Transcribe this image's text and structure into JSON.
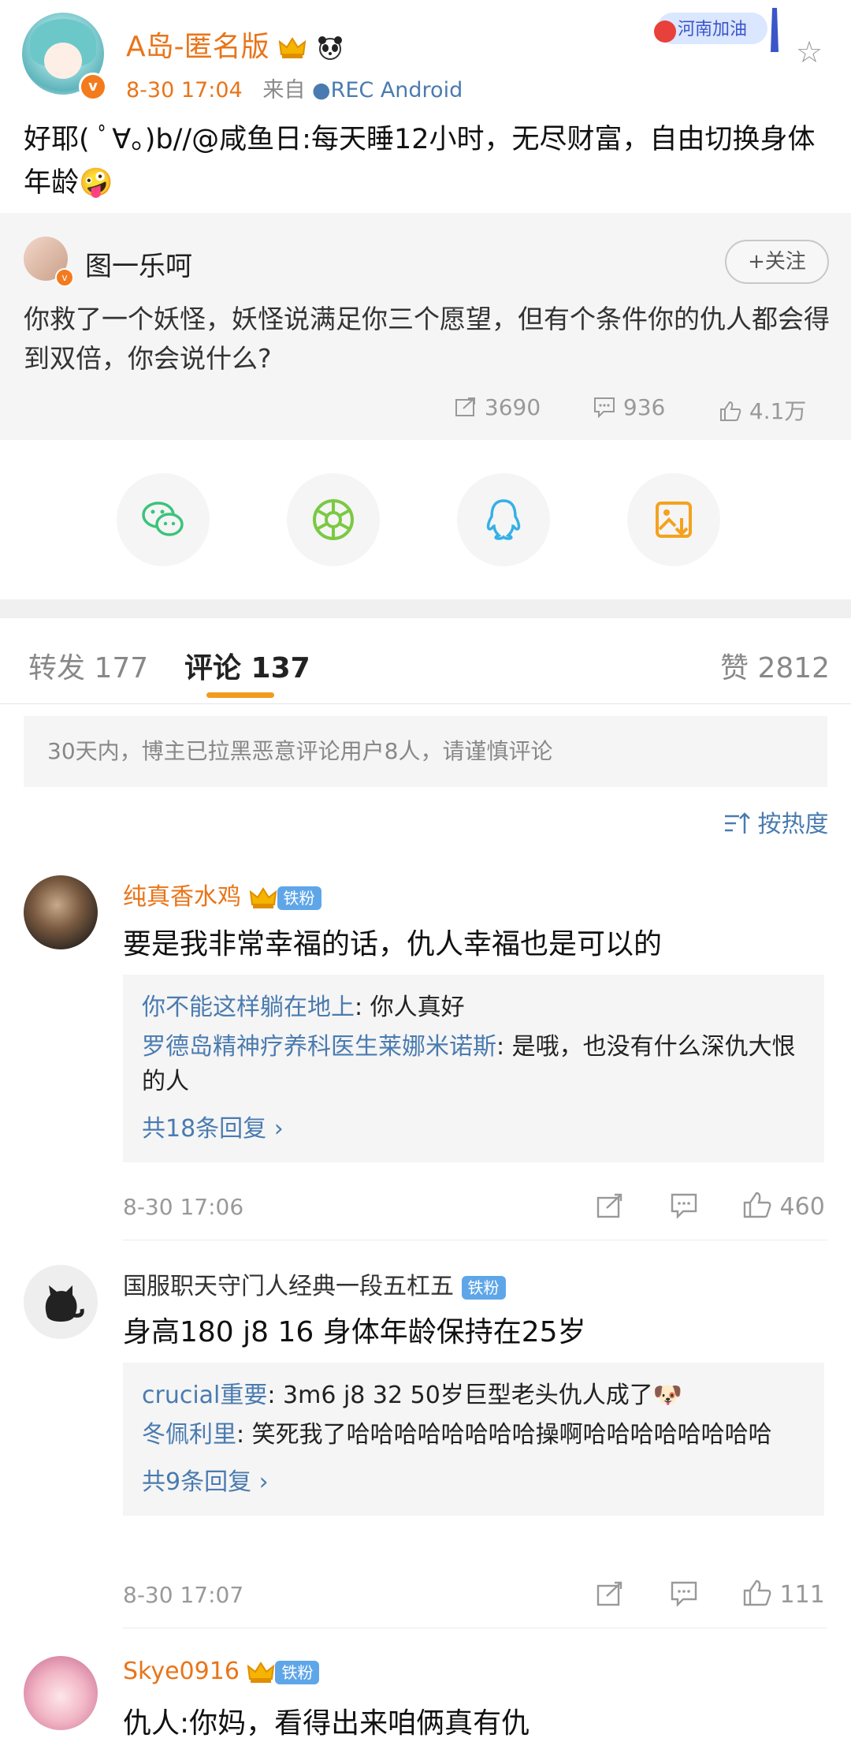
{
  "post": {
    "author": "A岛-匿名版",
    "time": "8-30 17:04",
    "source_prefix": "来自",
    "source": "REC Android",
    "text": "好耶( ﾟ∀。)b//@咸鱼日:每天睡12小时，无尽财富，自由切换身体年龄🤪",
    "banner_text": "河南加油"
  },
  "retweet": {
    "user": "图一乐呵",
    "follow_label": "+关注",
    "text": "你救了一个妖怪，妖怪说满足你三个愿望，但有个条件你的仇人都会得到双倍，你会说什么?",
    "reposts": "3690",
    "comments": "936",
    "likes": "4.1万"
  },
  "tabs": {
    "repost": "转发 177",
    "comment": "评论 137",
    "like": "赞 2812"
  },
  "notice": "30天内，博主已拉黑恶意评论用户8人，请谨慎评论",
  "sort_label": "按热度",
  "comments": [
    {
      "name": "纯真香水鸡",
      "badge": "铁粉",
      "text": "要是我非常幸福的话，仇人幸福也是可以的",
      "replies": [
        {
          "name": "你不能这样躺在地上",
          "text": ": 你人真好"
        },
        {
          "name": "罗德岛精神疗养科医生莱娜米诺斯",
          "text": ": 是哦，也没有什么深仇大恨的人"
        }
      ],
      "more": "共18条回复 ›",
      "time": "8-30 17:06",
      "likes": "460"
    },
    {
      "name": "国服职天守门人经典一段五杠五",
      "badge": "铁粉",
      "text": "身高180 j8 16 身体年龄保持在25岁",
      "replies": [
        {
          "name": "crucial重要",
          "text": ": 3m6  j8 32  50岁巨型老头仇人成了🐶"
        },
        {
          "name": "冬佩利里",
          "text": ": 笑死我了哈哈哈哈哈哈哈哈操啊哈哈哈哈哈哈哈哈"
        }
      ],
      "more": "共9条回复 ›",
      "time": "8-30 17:07",
      "likes": "111"
    },
    {
      "name": "Skye0916",
      "badge": "铁粉",
      "text": "仇人:你妈，看得出来咱俩真有仇"
    }
  ],
  "colors": {
    "accent_orange": "#e8751a",
    "link_blue": "#4a7bb0",
    "tab_underline": "#f29b1e",
    "wechat": "#3bc37a",
    "moments": "#7ac943",
    "qq": "#35b0e6",
    "save": "#f4a21d"
  }
}
